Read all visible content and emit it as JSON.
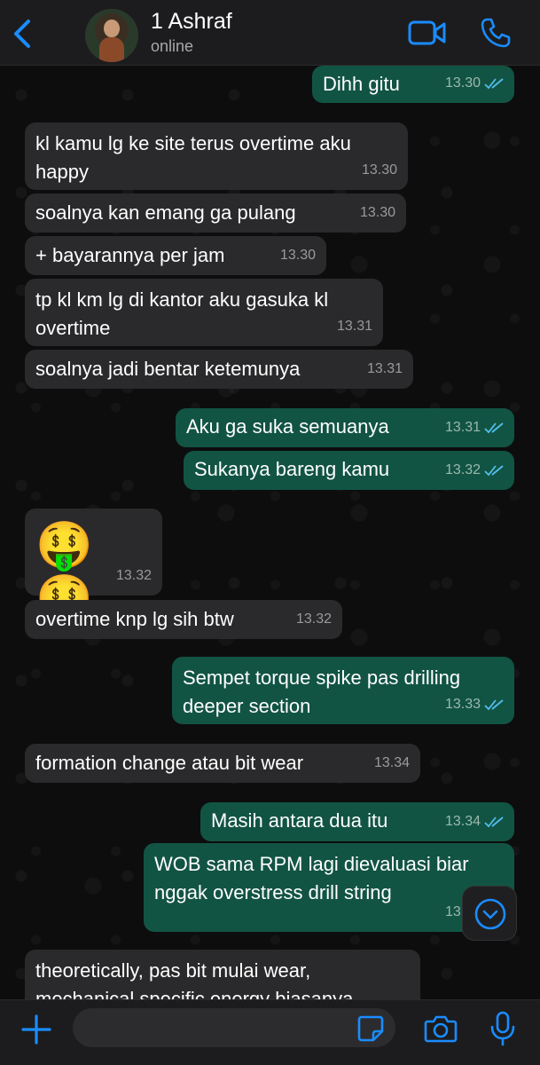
{
  "header": {
    "back_icon": "chevron-left-icon",
    "contact_name": "1 Ashraf",
    "status": "online",
    "video_icon": "video-camera-icon",
    "call_icon": "phone-icon",
    "accent_color": "#1a8cff"
  },
  "messages": [
    {
      "dir": "out",
      "text": "Dihh gitu",
      "time": "13.30",
      "read": true
    },
    {
      "dir": "in",
      "text": "kl kamu lg ke site terus overtime aku happy",
      "time": "13.30"
    },
    {
      "dir": "in",
      "text": "soalnya kan emang ga pulang",
      "time": "13.30"
    },
    {
      "dir": "in",
      "text": "+ bayarannya per jam",
      "time": "13.30"
    },
    {
      "dir": "in",
      "text": "tp kl km lg di kantor aku gasuka kl overtime",
      "time": "13.31"
    },
    {
      "dir": "in",
      "text": "soalnya jadi bentar ketemunya",
      "time": "13.31"
    },
    {
      "dir": "out",
      "text": "Aku ga suka semuanya",
      "time": "13.31",
      "read": true
    },
    {
      "dir": "out",
      "text": "Sukanya bareng kamu",
      "time": "13.32",
      "read": true
    },
    {
      "dir": "in",
      "text": "🤑 🤑",
      "time": "13.32",
      "emoji": true
    },
    {
      "dir": "in",
      "text": "overtime knp lg sih btw",
      "time": "13.32"
    },
    {
      "dir": "out",
      "text": "Sempet torque spike pas drilling deeper section",
      "time": "13.33",
      "read": true
    },
    {
      "dir": "in",
      "text": "formation change atau bit wear",
      "time": "13.34"
    },
    {
      "dir": "out",
      "text": "Masih antara dua itu",
      "time": "13.34",
      "read": true
    },
    {
      "dir": "out",
      "text": "WOB sama RPM lagi dievaluasi biar nggak overstress drill string",
      "time": "13.34",
      "read": true
    },
    {
      "dir": "in",
      "text": "theoretically, pas bit mulai wear, mechanical specific energy biasanya",
      "time": ""
    }
  ],
  "colors": {
    "incoming_bubble": "#2a2a2c",
    "outgoing_bubble": "#125444",
    "read_ticks": "#53bdeb"
  },
  "input_bar": {
    "placeholder": "",
    "plus_icon": "plus-icon",
    "sticker_icon": "sticker-icon",
    "camera_icon": "camera-icon",
    "mic_icon": "microphone-icon"
  },
  "scroll_down_icon": "chevron-down-circle-icon"
}
